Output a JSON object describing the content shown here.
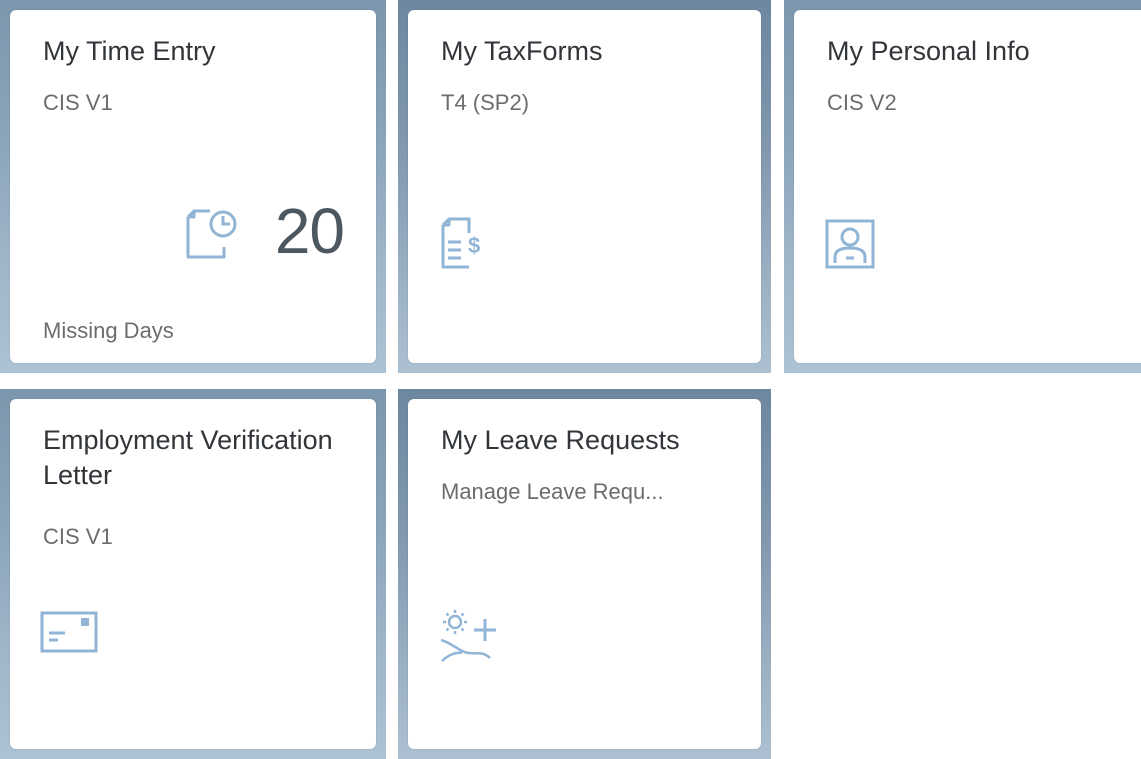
{
  "tiles": [
    {
      "title": "My Time Entry",
      "subtitle": "CIS V1",
      "icon": "time-entry-icon",
      "kpi_value": "20",
      "footer": "Missing Days"
    },
    {
      "title": "My TaxForms",
      "subtitle": "T4 (SP2)",
      "icon": "tax-document-icon"
    },
    {
      "title": "My Personal Info",
      "subtitle": "CIS V2",
      "icon": "personnel-view-icon"
    },
    {
      "title": "Employment Verification Letter",
      "subtitle": "CIS V1",
      "icon": "letter-icon"
    },
    {
      "title": "My Leave Requests",
      "subtitle": "Manage Leave Requ...",
      "icon": "leave-request-icon"
    }
  ],
  "colors": {
    "icon": "#91b5d6",
    "title": "#32363a",
    "subtitle": "#6a6d70",
    "kpi": "#4d5760",
    "tile_frame": "#8aa3b9"
  }
}
